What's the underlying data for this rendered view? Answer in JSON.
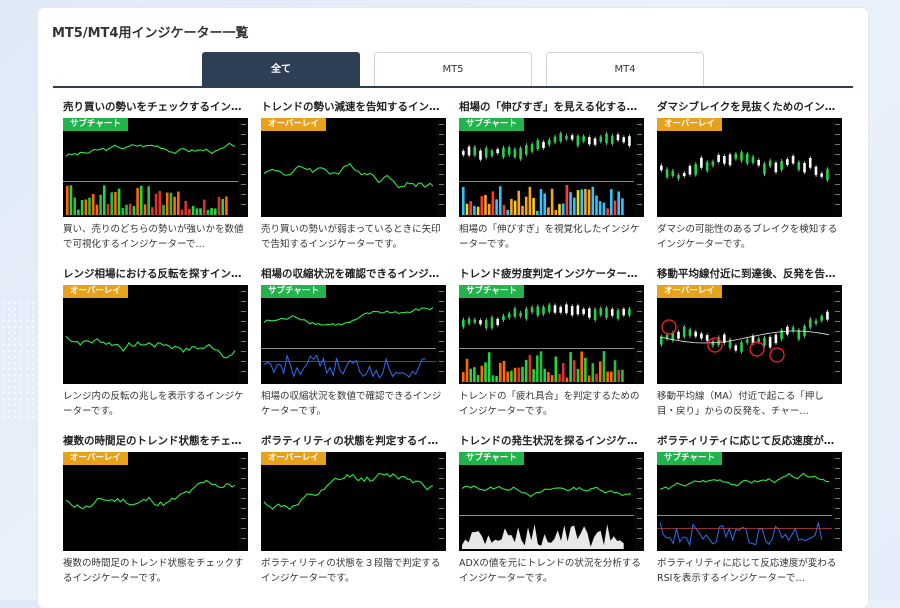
{
  "page": {
    "title": "MT5/MT4用インジケーター一覧"
  },
  "tabs": [
    {
      "label": "全て",
      "active": true
    },
    {
      "label": "MT5",
      "active": false
    },
    {
      "label": "MT4",
      "active": false
    }
  ],
  "colors": {
    "accent_dark": "#2e3e55",
    "badge_subchart": "#22b34d",
    "badge_overlay": "#e6a21c"
  },
  "cards": [
    {
      "title": "売り買いの勢いをチェックするイン…",
      "badge": "サブチャート",
      "badge_type": "sub",
      "chart_style": "line-hist",
      "description": "買い、売りのどちらの勢いが強いかを数値で可視化するインジケーターで…"
    },
    {
      "title": "トレンドの勢い減速を告知するイン…",
      "badge": "オーバーレイ",
      "badge_type": "ovl",
      "chart_style": "line",
      "description": "売り買いの勢いが弱まっているときに矢印で告知するインジケーターです。"
    },
    {
      "title": "相場の「伸びすぎ」を見える化する…",
      "badge": "サブチャート",
      "badge_type": "sub",
      "chart_style": "candle-multicolor",
      "description": "相場の「伸びすぎ」を視覚化したインジケーターです。"
    },
    {
      "title": "ダマシブレイクを見抜くためのイン…",
      "badge": "オーバーレイ",
      "badge_type": "ovl",
      "chart_style": "candle",
      "description": "ダマシの可能性のあるブレイクを検知するインジケーターです。"
    },
    {
      "title": "レンジ相場における反転を探すイン…",
      "badge": "オーバーレイ",
      "badge_type": "ovl",
      "chart_style": "line",
      "description": "レンジ内の反転の兆しを表示するインジケーターです。"
    },
    {
      "title": "相場の収縮状況を確認できるインジ…",
      "badge": "サブチャート",
      "badge_type": "sub",
      "chart_style": "line-osc",
      "description": "相場の収縮状況を数値で確認できるインジケーターです。"
    },
    {
      "title": "トレンド疲労度判定インジケーター…",
      "badge": "サブチャート",
      "badge_type": "sub",
      "chart_style": "candle-hist",
      "description": "トレンドの「疲れ具合」を判定するためのインジケーターです。"
    },
    {
      "title": "移動平均線付近に到達後、反発を告…",
      "badge": "オーバーレイ",
      "badge_type": "ovl",
      "chart_style": "candle-circles",
      "description": "移動平均線（MA）付近で起こる「押し目・戻り」からの反発を、チャー…"
    },
    {
      "title": "複数の時間足のトレンド状態をチェ…",
      "badge": "オーバーレイ",
      "badge_type": "ovl",
      "chart_style": "line",
      "description": "複数の時間足のトレンド状態をチェックするインジケーターです。"
    },
    {
      "title": "ボラティリティの状態を判定するイ…",
      "badge": "オーバーレイ",
      "badge_type": "ovl",
      "chart_style": "line",
      "description": "ボラティリティの状態を３段階で判定するインジケーターです。"
    },
    {
      "title": "トレンドの発生状況を探るインジケ…",
      "badge": "サブチャート",
      "badge_type": "sub",
      "chart_style": "line-area",
      "description": "ADXの値を元にトレンドの状況を分析するインジケーターです。"
    },
    {
      "title": "ボラティリティに応じて反応速度が…",
      "badge": "サブチャート",
      "badge_type": "sub",
      "chart_style": "line-osc",
      "description": "ボラティリティに応じて反応速度が変わるRSIを表示するインジケーターで…"
    }
  ]
}
